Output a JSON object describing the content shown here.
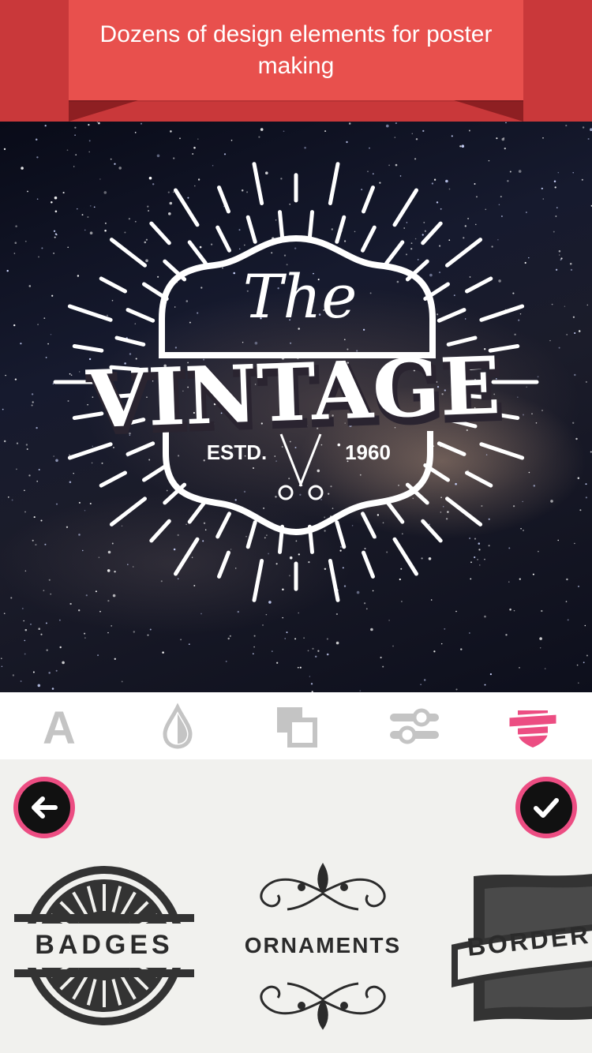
{
  "banner": {
    "text": "Dozens of design elements for poster making"
  },
  "poster": {
    "headline_top": "The",
    "headline_main": "VINTAGE",
    "estd_label": "ESTD.",
    "year": "1960",
    "emblem_icon": "scissors-icon"
  },
  "toolbar": {
    "tools": [
      {
        "name": "text",
        "icon": "text-icon",
        "glyph": "A",
        "active": false
      },
      {
        "name": "color",
        "icon": "color-drop-icon",
        "active": false
      },
      {
        "name": "layers",
        "icon": "layers-icon",
        "active": false
      },
      {
        "name": "adjust",
        "icon": "sliders-icon",
        "active": false
      },
      {
        "name": "badges",
        "icon": "badge-ribbon-icon",
        "active": true
      }
    ],
    "inactive_color": "#c4c4c4",
    "active_color": "#ec4d82"
  },
  "panel": {
    "back_icon": "arrow-left-icon",
    "done_icon": "check-icon",
    "categories": [
      {
        "label": "BADGES"
      },
      {
        "label": "ORNAMENTS"
      },
      {
        "label": "BORDER"
      }
    ]
  },
  "colors": {
    "banner_red": "#e8504d",
    "banner_dark": "#c9383a",
    "accent_pink": "#ec4d82"
  }
}
